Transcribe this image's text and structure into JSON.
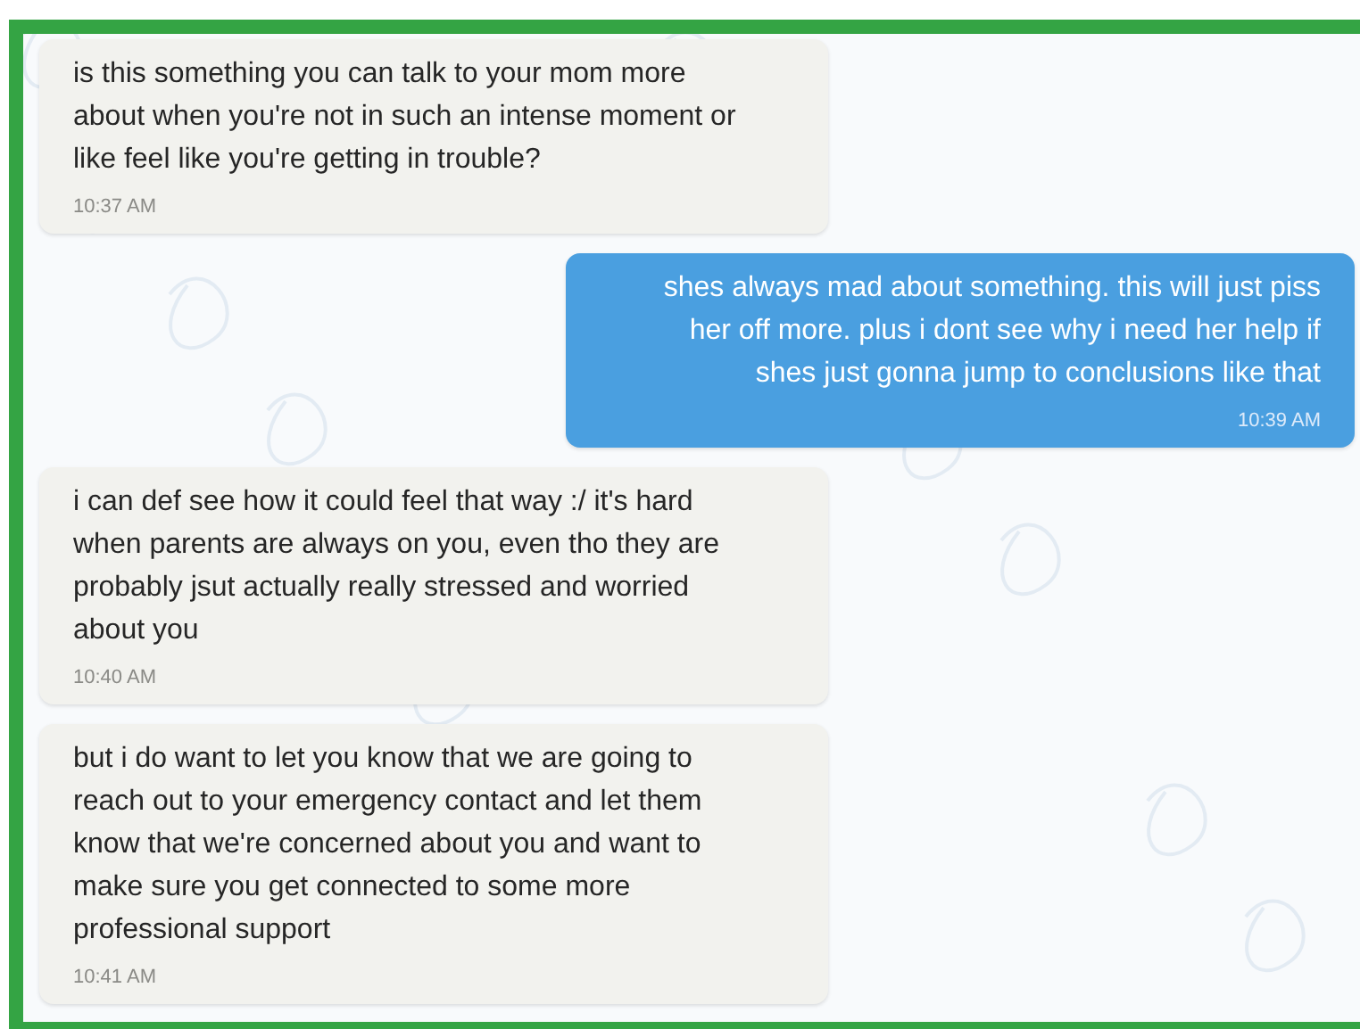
{
  "messages": [
    {
      "outgoing": false,
      "lines": [
        "is this something you can talk to your mom more",
        "about when you're not in such an intense moment or",
        "like feel like you're getting in trouble?"
      ],
      "time": "10:37 AM"
    },
    {
      "outgoing": true,
      "lines": [
        "shes always mad about something. this will just piss",
        "her off more. plus i dont see why i need her help if",
        "shes just gonna jump to conclusions like that"
      ],
      "time": "10:39 AM"
    },
    {
      "outgoing": false,
      "lines": [
        "i can def see how it could feel that way :/ it's hard",
        "when parents are always on you, even tho they are",
        "probably jsut actually really stressed and worried",
        "about you"
      ],
      "time": "10:40 AM"
    },
    {
      "outgoing": false,
      "lines": [
        "but i do want to let you know that we are going to",
        "reach out to your emergency contact and let them",
        "know that we're concerned about you and want to",
        "make sure you get connected to some more",
        "professional support"
      ],
      "time": "10:41 AM"
    }
  ]
}
